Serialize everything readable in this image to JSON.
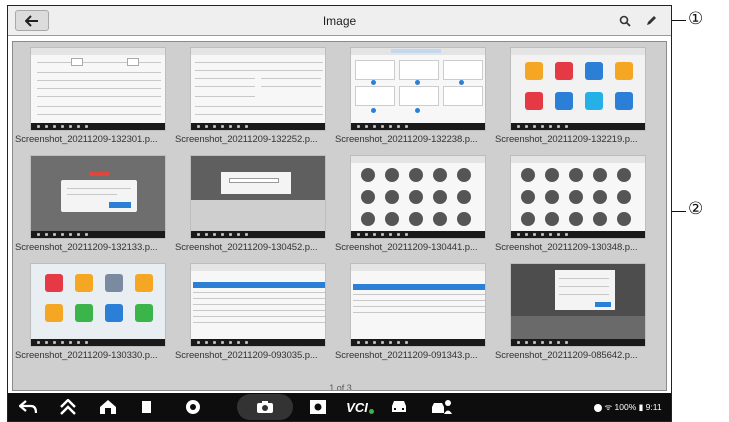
{
  "toolbar": {
    "title": "Image"
  },
  "gallery": {
    "images": [
      {
        "caption": "Screenshot_20211209-132301.p..."
      },
      {
        "caption": "Screenshot_20211209-132252.p..."
      },
      {
        "caption": "Screenshot_20211209-132238.p..."
      },
      {
        "caption": "Screenshot_20211209-132219.p..."
      },
      {
        "caption": "Screenshot_20211209-132133.p..."
      },
      {
        "caption": "Screenshot_20211209-130452.p..."
      },
      {
        "caption": "Screenshot_20211209-130441.p..."
      },
      {
        "caption": "Screenshot_20211209-130348.p..."
      },
      {
        "caption": "Screenshot_20211209-130330.p..."
      },
      {
        "caption": "Screenshot_20211209-093035.p..."
      },
      {
        "caption": "Screenshot_20211209-091343.p..."
      },
      {
        "caption": "Screenshot_20211209-085642.p..."
      }
    ],
    "page_indicator": "1 of 3"
  },
  "system_bar": {
    "status_text": "100% ▮ 9:11",
    "vci_label": "VCI"
  },
  "callouts": {
    "one": "①",
    "two": "②"
  },
  "colors": {
    "accent": "#2b7fd6",
    "toolbar_bg": "#efefef",
    "gallery_bg": "#cfcfcf",
    "system_bar_bg": "#0d0d0d"
  }
}
